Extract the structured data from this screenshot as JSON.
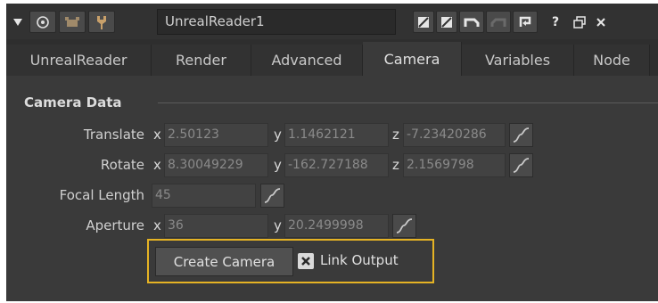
{
  "titlebar": {
    "node_name": "UnrealReader1",
    "help_label": "?"
  },
  "tabs": [
    {
      "label": "UnrealReader"
    },
    {
      "label": "Render"
    },
    {
      "label": "Advanced"
    },
    {
      "label": "Camera",
      "active": true
    },
    {
      "label": "Variables"
    },
    {
      "label": "Node"
    }
  ],
  "section": {
    "title": "Camera Data"
  },
  "translate": {
    "label": "Translate",
    "x_axis": "x",
    "x": "2.50123",
    "y_axis": "y",
    "y": "1.1462121",
    "z_axis": "z",
    "z": "-7.23420286"
  },
  "rotate": {
    "label": "Rotate",
    "x_axis": "x",
    "x": "8.30049229",
    "y_axis": "y",
    "y": "-162.727188",
    "z_axis": "z",
    "z": "2.1569798"
  },
  "focal": {
    "label": "Focal Length",
    "value": "45"
  },
  "aperture": {
    "label": "Aperture",
    "x_axis": "x",
    "x": "36",
    "y_axis": "y",
    "y": "20.2499998"
  },
  "actions": {
    "create_label": "Create Camera",
    "link_label": "Link Output",
    "link_checked": true
  },
  "colors": {
    "highlight": "#e5b324",
    "panel_bg": "#3a3a3a",
    "field_text": "#8a8a8a"
  }
}
